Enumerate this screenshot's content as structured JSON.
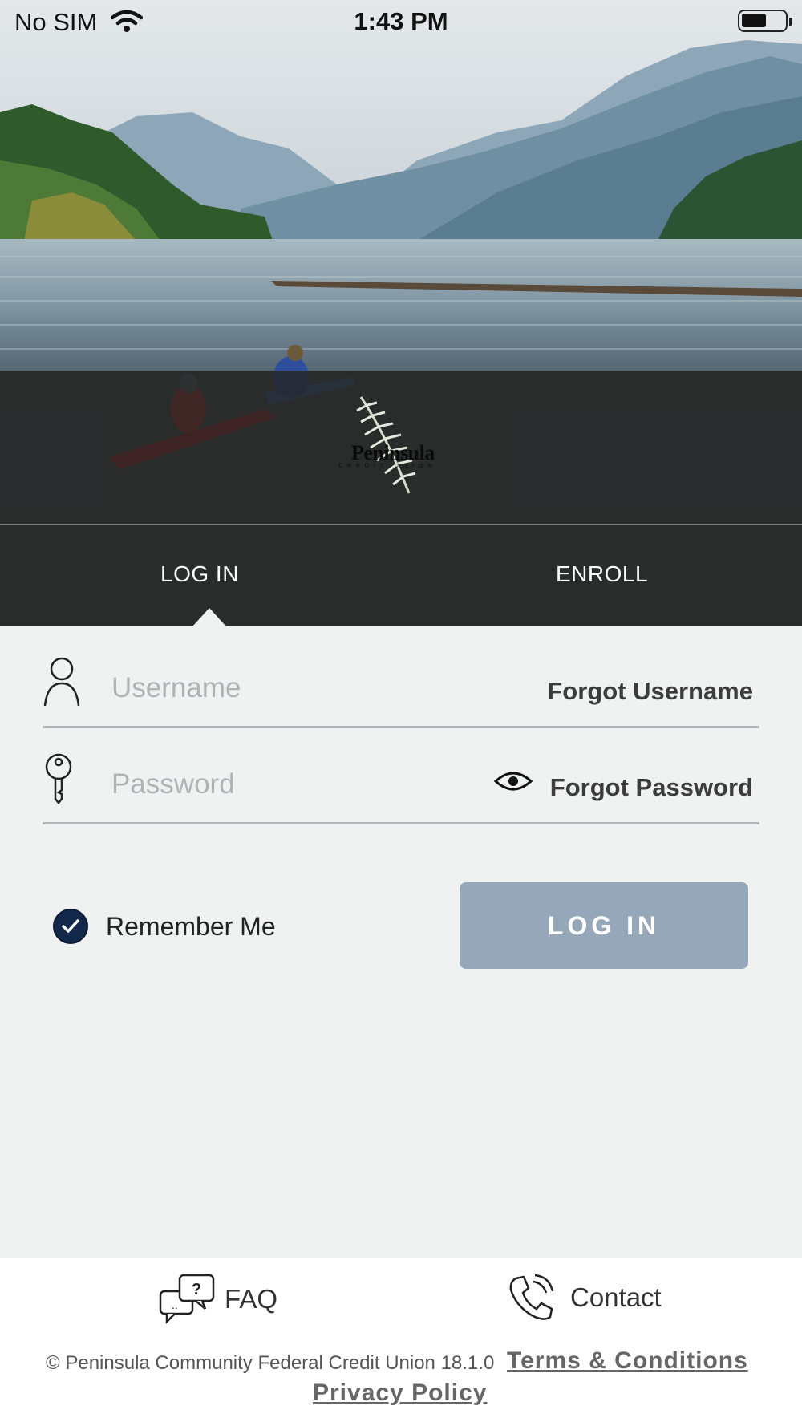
{
  "status_bar": {
    "carrier": "No SIM",
    "time": "1:43 PM"
  },
  "brand": {
    "logo_text": "Peninsula",
    "logo_subtext": "CREDIT UNION"
  },
  "tabs": [
    {
      "label": "LOG IN"
    },
    {
      "label": "ENROLL"
    }
  ],
  "login_form": {
    "username_placeholder": "Username",
    "username_value": "",
    "forgot_username": "Forgot Username",
    "password_placeholder": "Password",
    "password_value": "",
    "forgot_password": "Forgot Password",
    "remember_me": "Remember Me",
    "remember_me_checked": true,
    "login_button": "LOG IN"
  },
  "footer": {
    "faq_label": "FAQ",
    "contact_label": "Contact",
    "copyright": "© Peninsula Community Federal Credit Union 18.1.0",
    "terms_link": "Terms & Conditions",
    "privacy_link": "Privacy Policy"
  },
  "colors": {
    "accent_dark": "#13294b",
    "button_disabled": "#97a7ba",
    "tab_bar": "#3a3a3a"
  }
}
